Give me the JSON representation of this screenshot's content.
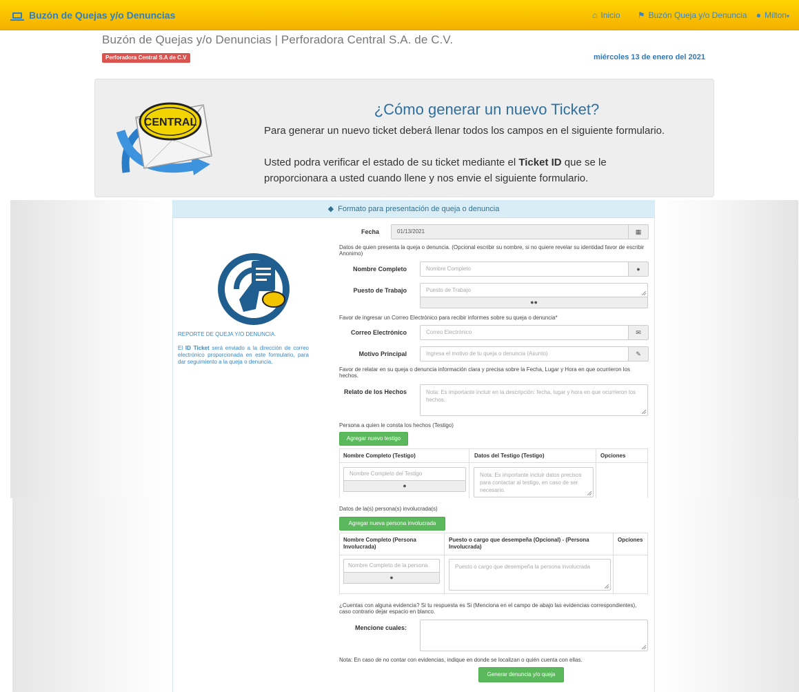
{
  "navbar": {
    "brand": "Buzón de Quejas y/o Denuncias",
    "items": [
      {
        "label": "Inicio",
        "icon": "home-icon"
      },
      {
        "label": "Buzón Queja y/o Denuncia",
        "icon": "flag-icon"
      },
      {
        "label": "Milton",
        "icon": "user-icon"
      }
    ]
  },
  "header": {
    "title": "Buzón de Quejas y/o Denuncias | Perforadora Central S.A. de C.V.",
    "company_badge": "Perforadora Central S.A de C.V",
    "date": "miércoles 13 de enero del 2021"
  },
  "jumbotron": {
    "heading": "¿Cómo generar un nuevo Ticket?",
    "paragraph1": "Para generar un nuevo ticket deberá llenar todos los campos en el siguiente formulario.",
    "paragraph2_before": "Usted podra verificar el estado de su ticket mediante el ",
    "paragraph2_bold": "Ticket ID",
    "paragraph2_after": " que se le proporcionara a usted cuando llene y nos envie el siguiente formulario.",
    "logo_text": "CENTRAL"
  },
  "panel": {
    "heading": "Formato para presentación de queja o denuncia",
    "side_title": "REPORTE DE QUEJA Y/O DENUNCIA.",
    "side_desc_before": "El ",
    "side_desc_bold": "ID Ticket",
    "side_desc_after": " será enviado a la dirección de correo electrónico proporcionada en este formulario, para dar seguimiento a la queja o denuncia."
  },
  "form": {
    "fecha_label": "Fecha",
    "fecha_value": "01/13/2021",
    "note_datos": "Datos de quien presenta la queja o denuncia. (Opcional escribir su nombre, si no quiere revelar su identidad favor de escribir Anonimo)",
    "nombre_label": "Nombre Completo",
    "nombre_placeholder": "Nombre Completo",
    "puesto_label": "Puesto de Trabajo",
    "puesto_placeholder": "Puesto de Trabajo",
    "note_correo": "Favor de ingresar un Correo Electrónico para recibir informes sobre su queja o denuncia*",
    "correo_label": "Correo Electrónico",
    "correo_placeholder": "Correo Electrónico",
    "motivo_label": "Motivo Principal",
    "motivo_placeholder": "Ingresa el motivo de tu queja o denuncia (Asunto)",
    "note_relato": "Favor de relatar en su queja o denuncia información clara y precisa sobre la Fecha, Lugar y Hora en que ocurrieron los hechos.",
    "relato_label": "Relato de los Hechos",
    "relato_placeholder": "Nota: Es importante incluir en la descripción: fecha, lugar y hora en que ocurrieron los hechos.",
    "note_testigo": "Persona a quien le consta los hechos (Testigo)",
    "add_testigo_button": "Agregar nuevo testigo",
    "testigo_table": {
      "headers": [
        "Nombre Completo (Testigo)",
        "Datos del Testigo (Testigo)",
        "Opciones"
      ],
      "name_placeholder": "Nombre Completo del Testigo",
      "data_placeholder": "Nota: Es importante incluir datos precisos para contactar al testigo, en caso de ser necesario."
    },
    "note_involucrada": "Datos de la(s) persona(s) involucrada(s)",
    "add_involucrada_button": "Agregar nueva persona involucrada",
    "involucrada_table": {
      "headers": [
        "Nombre Completo (Persona Involucrada)",
        "Puesto o cargo que desempeña (Opcional) - (Persona Involucrada)",
        "Opciones"
      ],
      "name_placeholder": "Nombre Completo de la persona",
      "data_placeholder": "Puesto o cargo que desempeña la persona involucrada"
    },
    "note_evidencia": "¿Cuentas con alguna evidencia? Si tu respuesta es Si (Menciona en el campo de abajo las evidencias correspondientes), caso contrario dejar espacio en blanco.",
    "mencione_label": "Mencione cuales:",
    "note_final": "Nota: En caso de no contar con evidencias, indique en donde se localizan o quién cuenta con ellas.",
    "submit_button": "Generar denuncia y/o queja"
  }
}
